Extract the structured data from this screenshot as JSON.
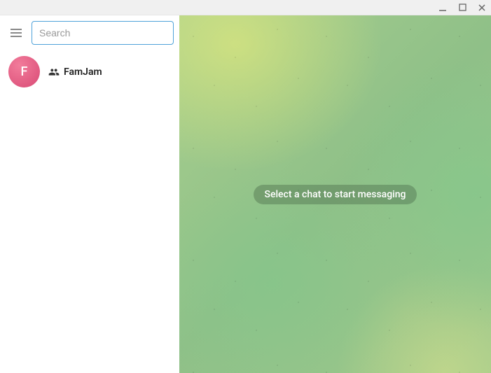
{
  "window": {
    "minimize_icon": "minimize",
    "maximize_icon": "maximize",
    "close_icon": "close"
  },
  "sidebar": {
    "search_placeholder": "Search",
    "search_value": "",
    "chats": [
      {
        "avatar_letter": "F",
        "name": "FamJam",
        "type": "group"
      }
    ]
  },
  "chat_area": {
    "empty_message": "Select a chat to start messaging"
  }
}
